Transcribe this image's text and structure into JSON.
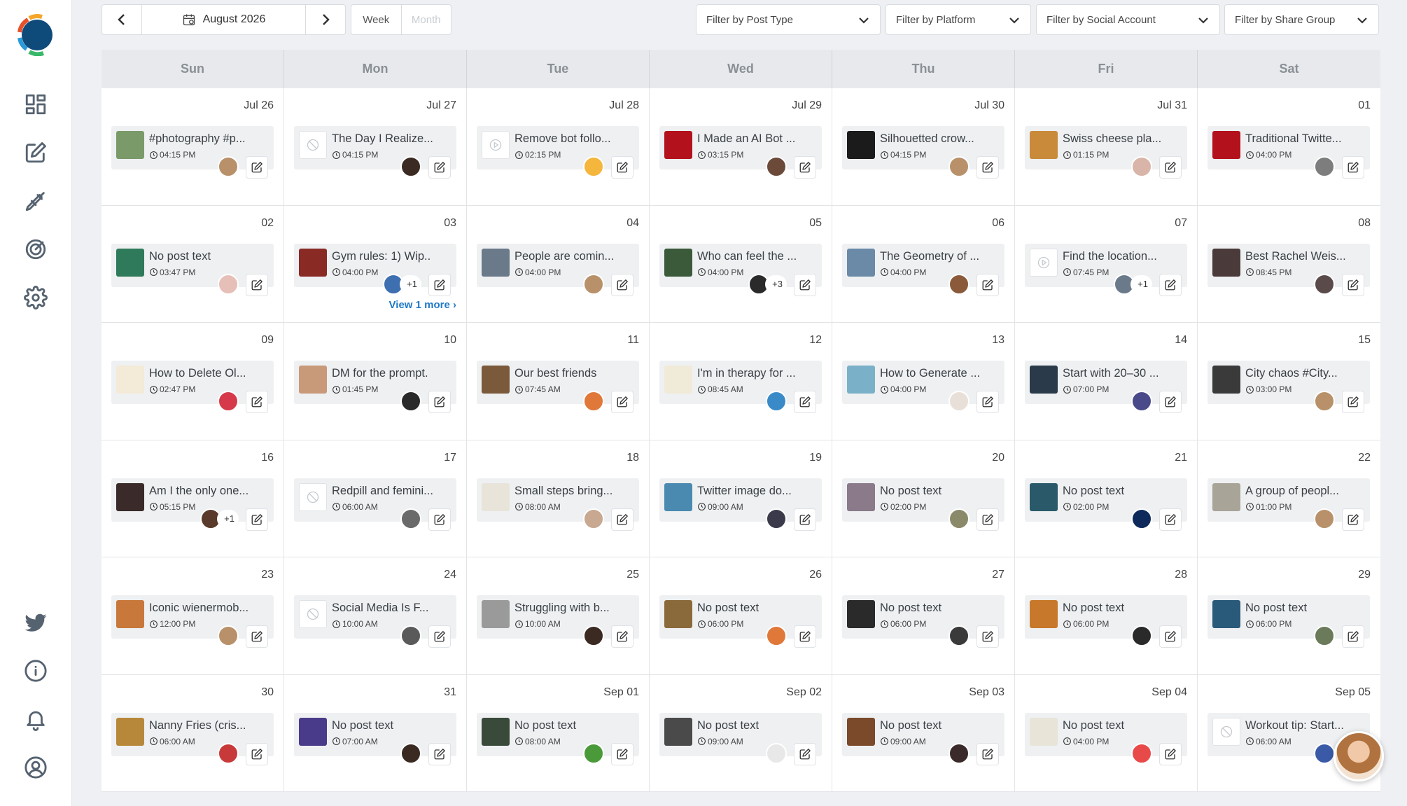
{
  "app": {
    "accent": "#1d78c8",
    "sidebar": {
      "top_items": [
        {
          "name": "dashboard-icon"
        },
        {
          "name": "compose-icon"
        },
        {
          "name": "drafts-icon"
        },
        {
          "name": "analytics-icon"
        },
        {
          "name": "settings-icon"
        }
      ],
      "bottom_items": [
        {
          "name": "twitter-icon"
        },
        {
          "name": "info-icon"
        },
        {
          "name": "notifications-icon"
        },
        {
          "name": "profile-icon"
        }
      ]
    }
  },
  "toolbar": {
    "month_label": "August 2026",
    "view_week": "Week",
    "view_month": "Month",
    "filters": [
      "Filter by Post Type",
      "Filter by Platform",
      "Filter by Social Account",
      "Filter by Share Group"
    ]
  },
  "calendar": {
    "weekdays": [
      "Sun",
      "Mon",
      "Tue",
      "Wed",
      "Thu",
      "Fri",
      "Sat"
    ],
    "view_more_label": "View 1 more",
    "weeks": [
      [
        {
          "day": "Jul 26",
          "text": "#photography #p...",
          "time": "04:15 PM",
          "thumb": "#7a9a6a",
          "avatars": [
            "#b8916a"
          ]
        },
        {
          "day": "Jul 27",
          "text": "The Day I Realize...",
          "time": "04:15 PM",
          "thumb": "blank",
          "avatars": [
            "#3b2a22"
          ]
        },
        {
          "day": "Jul 28",
          "text": "Remove bot follo...",
          "time": "02:15 PM",
          "thumb": "play",
          "avatars": [
            "#f4b63c"
          ]
        },
        {
          "day": "Jul 29",
          "text": "I Made an AI Bot ...",
          "time": "03:15 PM",
          "thumb": "#b3121d",
          "avatars": [
            "#6b4a3a"
          ]
        },
        {
          "day": "Jul 30",
          "text": "Silhouetted crow...",
          "time": "04:15 PM",
          "thumb": "#1b1b1b",
          "avatars": [
            "#b8916a"
          ]
        },
        {
          "day": "Jul 31",
          "text": "Swiss cheese pla...",
          "time": "01:15 PM",
          "thumb": "#c98a3a",
          "avatars": [
            "#d8b5a8"
          ]
        },
        {
          "day": "01",
          "text": "Traditional Twitte...",
          "time": "04:00 PM",
          "thumb": "#b3121d",
          "avatars": [
            "#7d7d7d"
          ]
        }
      ],
      [
        {
          "day": "02",
          "text": "No post text",
          "time": "03:47 PM",
          "thumb": "#2f7a5a",
          "avatars": [
            "#e6c0b8"
          ]
        },
        {
          "day": "03",
          "text": "Gym rules: 1) Wip..",
          "time": "04:00 PM",
          "thumb": "#8a2a24",
          "avatars": [
            "#3e6fb0"
          ],
          "plus": "+1",
          "more": true
        },
        {
          "day": "04",
          "text": "People are comin...",
          "time": "04:00 PM",
          "thumb": "#6a7a8a",
          "avatars": [
            "#b8916a"
          ]
        },
        {
          "day": "05",
          "text": "Who can feel the ...",
          "time": "04:00 PM",
          "thumb": "#3a5a3a",
          "avatars": [
            "#2a2a2a"
          ],
          "plus": "+3"
        },
        {
          "day": "06",
          "text": "The Geometry of ...",
          "time": "04:00 PM",
          "thumb": "#6a8aa8",
          "avatars": [
            "#8a5a3a"
          ]
        },
        {
          "day": "07",
          "text": "Find the location...",
          "time": "07:45 PM",
          "thumb": "play",
          "avatars": [
            "#6a7a8a"
          ],
          "plus": "+1"
        },
        {
          "day": "08",
          "text": "Best Rachel Weis...",
          "time": "08:45 PM",
          "thumb": "#4a3a3a",
          "avatars": [
            "#5a4a4a"
          ]
        }
      ],
      [
        {
          "day": "09",
          "text": "How to Delete Ol...",
          "time": "02:47 PM",
          "thumb": "#f3ead8",
          "avatars": [
            "#d63a4a"
          ]
        },
        {
          "day": "10",
          "text": "DM for the prompt.",
          "time": "01:45 PM",
          "thumb": "#c89a7a",
          "avatars": [
            "#2a2a2a"
          ]
        },
        {
          "day": "11",
          "text": "Our best friends",
          "time": "07:45 AM",
          "thumb": "#7a5a3a",
          "avatars": [
            "#e0783a"
          ]
        },
        {
          "day": "12",
          "text": "I'm in therapy for ...",
          "time": "08:45 AM",
          "thumb": "#f0ead8",
          "avatars": [
            "#3a8ac8"
          ]
        },
        {
          "day": "13",
          "text": "How to Generate ...",
          "time": "04:00 PM",
          "thumb": "#7ab0c8",
          "avatars": [
            "#e8e0d8"
          ]
        },
        {
          "day": "14",
          "text": "Start with 20–30 ...",
          "time": "07:00 PM",
          "thumb": "#2a3a4a",
          "avatars": [
            "#4a4a8a"
          ]
        },
        {
          "day": "15",
          "text": "City chaos #City...",
          "time": "03:00 PM",
          "thumb": "#3a3a3a",
          "avatars": [
            "#b8916a"
          ]
        }
      ],
      [
        {
          "day": "16",
          "text": "Am I the only one...",
          "time": "05:15 PM",
          "thumb": "#3a2a2a",
          "avatars": [
            "#5a3a2a"
          ],
          "plus": "+1"
        },
        {
          "day": "17",
          "text": "Redpill and femini...",
          "time": "06:00 AM",
          "thumb": "blank",
          "avatars": [
            "#6a6a6a"
          ]
        },
        {
          "day": "18",
          "text": "Small steps bring...",
          "time": "08:00 AM",
          "thumb": "#e8e4da",
          "avatars": [
            "#c8a890"
          ]
        },
        {
          "day": "19",
          "text": "Twitter image do...",
          "time": "09:00 AM",
          "thumb": "#4a8ab0",
          "avatars": [
            "#3a3a4a"
          ]
        },
        {
          "day": "20",
          "text": "No post text",
          "time": "02:00 PM",
          "thumb": "#8a7a8a",
          "avatars": [
            "#8a8a6a"
          ]
        },
        {
          "day": "21",
          "text": "No post text",
          "time": "02:00 PM",
          "thumb": "#2a5a6a",
          "avatars": [
            "#0e2a5a"
          ]
        },
        {
          "day": "22",
          "text": "A group of peopl...",
          "time": "01:00 PM",
          "thumb": "#a8a498",
          "avatars": [
            "#b8916a"
          ]
        }
      ],
      [
        {
          "day": "23",
          "text": "Iconic wienermob...",
          "time": "12:00 PM",
          "thumb": "#c8783a",
          "avatars": [
            "#b8916a"
          ]
        },
        {
          "day": "24",
          "text": "Social Media Is F...",
          "time": "10:00 AM",
          "thumb": "blank",
          "avatars": [
            "#5a5a5a"
          ]
        },
        {
          "day": "25",
          "text": "Struggling with b...",
          "time": "10:00 AM",
          "thumb": "#9a9a9a",
          "avatars": [
            "#3a2a22"
          ]
        },
        {
          "day": "26",
          "text": "No post text",
          "time": "06:00 PM",
          "thumb": "#8a6a3a",
          "avatars": [
            "#e0783a"
          ]
        },
        {
          "day": "27",
          "text": "No post text",
          "time": "06:00 PM",
          "thumb": "#2a2a2a",
          "avatars": [
            "#3a3a3a"
          ]
        },
        {
          "day": "28",
          "text": "No post text",
          "time": "06:00 PM",
          "thumb": "#c8782a",
          "avatars": [
            "#2a2a2a"
          ]
        },
        {
          "day": "29",
          "text": "No post text",
          "time": "06:00 PM",
          "thumb": "#2a5a7a",
          "avatars": [
            "#6a7a5a"
          ]
        }
      ],
      [
        {
          "day": "30",
          "text": "Nanny Fries (cris...",
          "time": "06:00 AM",
          "thumb": "#b8883a",
          "avatars": [
            "#c83a3a"
          ]
        },
        {
          "day": "31",
          "text": "No post text",
          "time": "07:00 AM",
          "thumb": "#4a3a8a",
          "avatars": [
            "#3a2a22"
          ]
        },
        {
          "day": "Sep 01",
          "text": "No post text",
          "time": "08:00 AM",
          "thumb": "#3a4a3a",
          "avatars": [
            "#4a9a3a"
          ]
        },
        {
          "day": "Sep 02",
          "text": "No post text",
          "time": "09:00 AM",
          "thumb": "#4a4a4a",
          "avatars": [
            "#e8e8e8"
          ]
        },
        {
          "day": "Sep 03",
          "text": "No post text",
          "time": "09:00 AM",
          "thumb": "#7a4a2a",
          "avatars": [
            "#3a2a2a"
          ]
        },
        {
          "day": "Sep 04",
          "text": "No post text",
          "time": "04:00 PM",
          "thumb": "#e8e4d8",
          "avatars": [
            "#e84a4a"
          ]
        },
        {
          "day": "Sep 05",
          "text": "Workout tip: Start...",
          "time": "06:00 AM",
          "thumb": "blank",
          "avatars": [
            "#3a5aa8"
          ]
        }
      ]
    ]
  }
}
